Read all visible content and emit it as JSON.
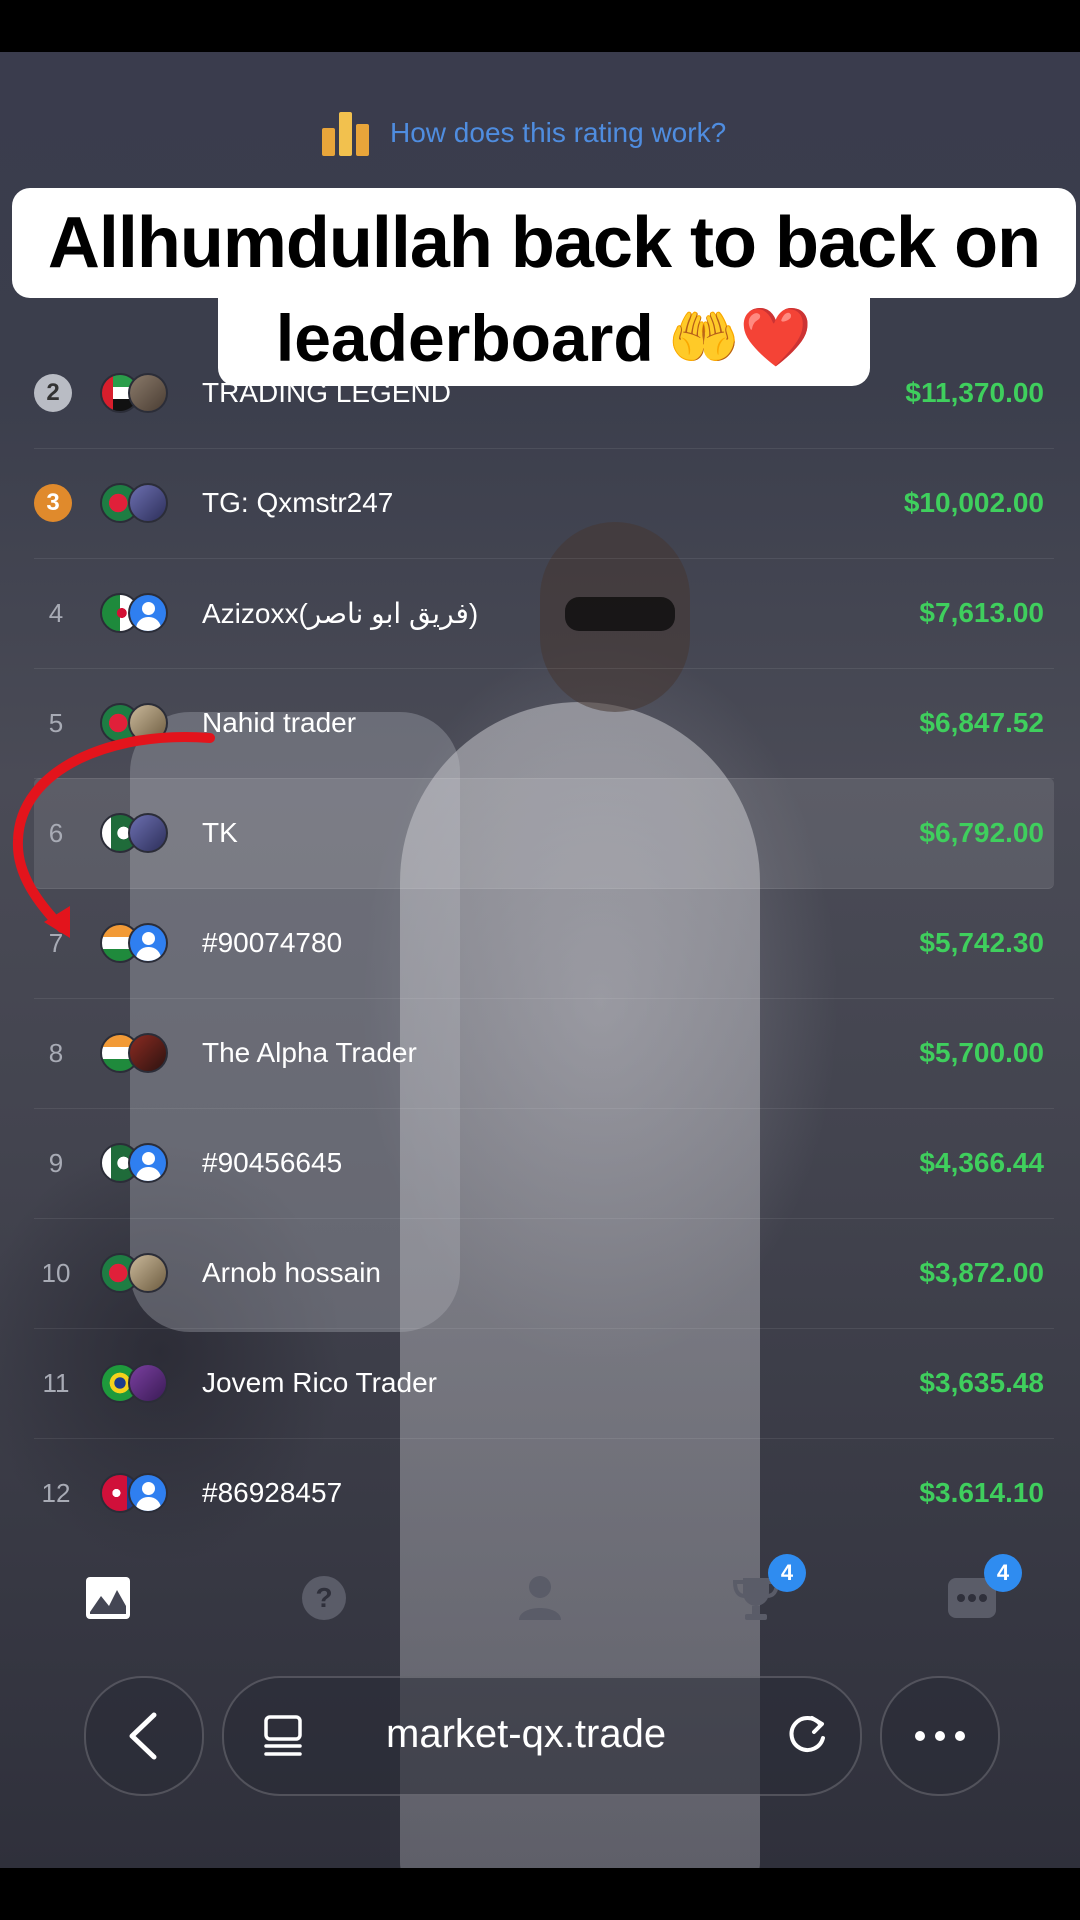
{
  "header": {
    "rating_link": "How does this rating work?"
  },
  "caption": {
    "line1": "Allhumdullah back to back on",
    "line2": "leaderboard",
    "emoji": "🤲❤️"
  },
  "leaderboard": {
    "rows": [
      {
        "rank": "2",
        "name": "TRADING LEGEND",
        "amount": "$11,370.00",
        "flag": "UAE",
        "medal": "silver"
      },
      {
        "rank": "3",
        "name": "TG: Qxmstr247",
        "amount": "$10,002.00",
        "flag": "Bangladesh",
        "medal": "bronze"
      },
      {
        "rank": "4",
        "name": "Azizoxx(فريق ابو ناصر)",
        "amount": "$7,613.00",
        "flag": "Algeria"
      },
      {
        "rank": "5",
        "name": "Nahid trader",
        "amount": "$6,847.52",
        "flag": "Bangladesh"
      },
      {
        "rank": "6",
        "name": "TK",
        "amount": "$6,792.00",
        "flag": "Pakistan"
      },
      {
        "rank": "7",
        "name": "#90074780",
        "amount": "$5,742.30",
        "flag": "India"
      },
      {
        "rank": "8",
        "name": "The Alpha Trader",
        "amount": "$5,700.00",
        "flag": "India"
      },
      {
        "rank": "9",
        "name": "#90456645",
        "amount": "$4,366.44",
        "flag": "Pakistan"
      },
      {
        "rank": "10",
        "name": "Arnob hossain",
        "amount": "$3,872.00",
        "flag": "Bangladesh"
      },
      {
        "rank": "11",
        "name": "Jovem Rico Trader",
        "amount": "$3,635.48",
        "flag": "Brazil"
      },
      {
        "rank": "12",
        "name": "#86928457",
        "amount": "$3.614.10",
        "flag": "Nepal"
      }
    ]
  },
  "nav": {
    "trophy_badge": "4",
    "chat_badge": "4"
  },
  "browser": {
    "url": "market-qx.trade"
  },
  "colors": {
    "amount_green": "#3fcf5d",
    "link_blue": "#4f8de0",
    "badge_blue": "#2f8cf0",
    "arrow_red": "#e3141c"
  }
}
